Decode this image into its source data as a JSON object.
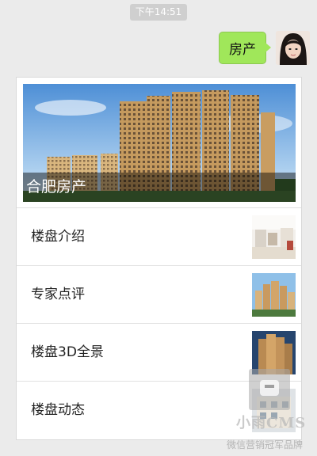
{
  "chat": {
    "time": "下午14:51",
    "message": "房产"
  },
  "card": {
    "hero_caption": "合肥房产",
    "items": [
      {
        "label": "楼盘介绍",
        "thumb_icon": "interior-photo"
      },
      {
        "label": "专家点评",
        "thumb_icon": "buildings-photo"
      },
      {
        "label": "楼盘3D全景",
        "thumb_icon": "tower-photo"
      },
      {
        "label": "楼盘动态",
        "thumb_icon": "apartment-photo"
      }
    ]
  },
  "watermark": {
    "title": "小雨CMS",
    "subtitle": "微信营销冠军品牌"
  },
  "colors": {
    "bubble": "#a0e75a",
    "chat_background": "#ebebeb",
    "time_badge": "#cfcfcf"
  }
}
